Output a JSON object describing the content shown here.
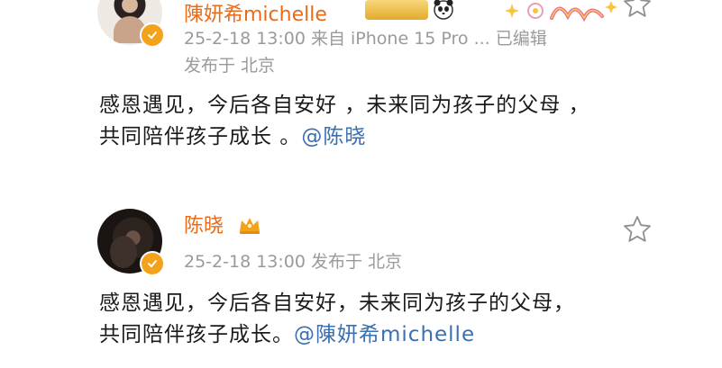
{
  "posts": [
    {
      "username": "陳妍希michelle",
      "meta_line1": "25-2-18 13:00  来自 iPhone 15 Pro ...  已编辑",
      "meta_line2": "发布于 北京",
      "content_line1": "感恩遇见，今后各自安好 ，未来同为孩子的父母 ，",
      "content_line2_text": "共同陪伴孩子成长 。",
      "mention": "@陈晓",
      "icons": [
        "avatar",
        "verified-badge-icon",
        "vip-badge-icon",
        "panda-icon",
        "sticker-icon",
        "star-icon"
      ]
    },
    {
      "username": "陈晓",
      "meta_line1": "25-2-18 13:00  发布于 北京",
      "content_line1": "感恩遇见，今后各自安好，未来同为孩子的父母，",
      "content_line2_text": "共同陪伴孩子成长。",
      "mention": "@陳妍希michelle",
      "icons": [
        "avatar",
        "verified-badge-icon",
        "crown-icon",
        "star-icon"
      ]
    }
  ],
  "colors": {
    "username": "#e86b1c",
    "meta": "#9a9a9a",
    "body_text": "#1a1a1a",
    "mention": "#3a6fb0",
    "verified": "#f2a31b"
  }
}
